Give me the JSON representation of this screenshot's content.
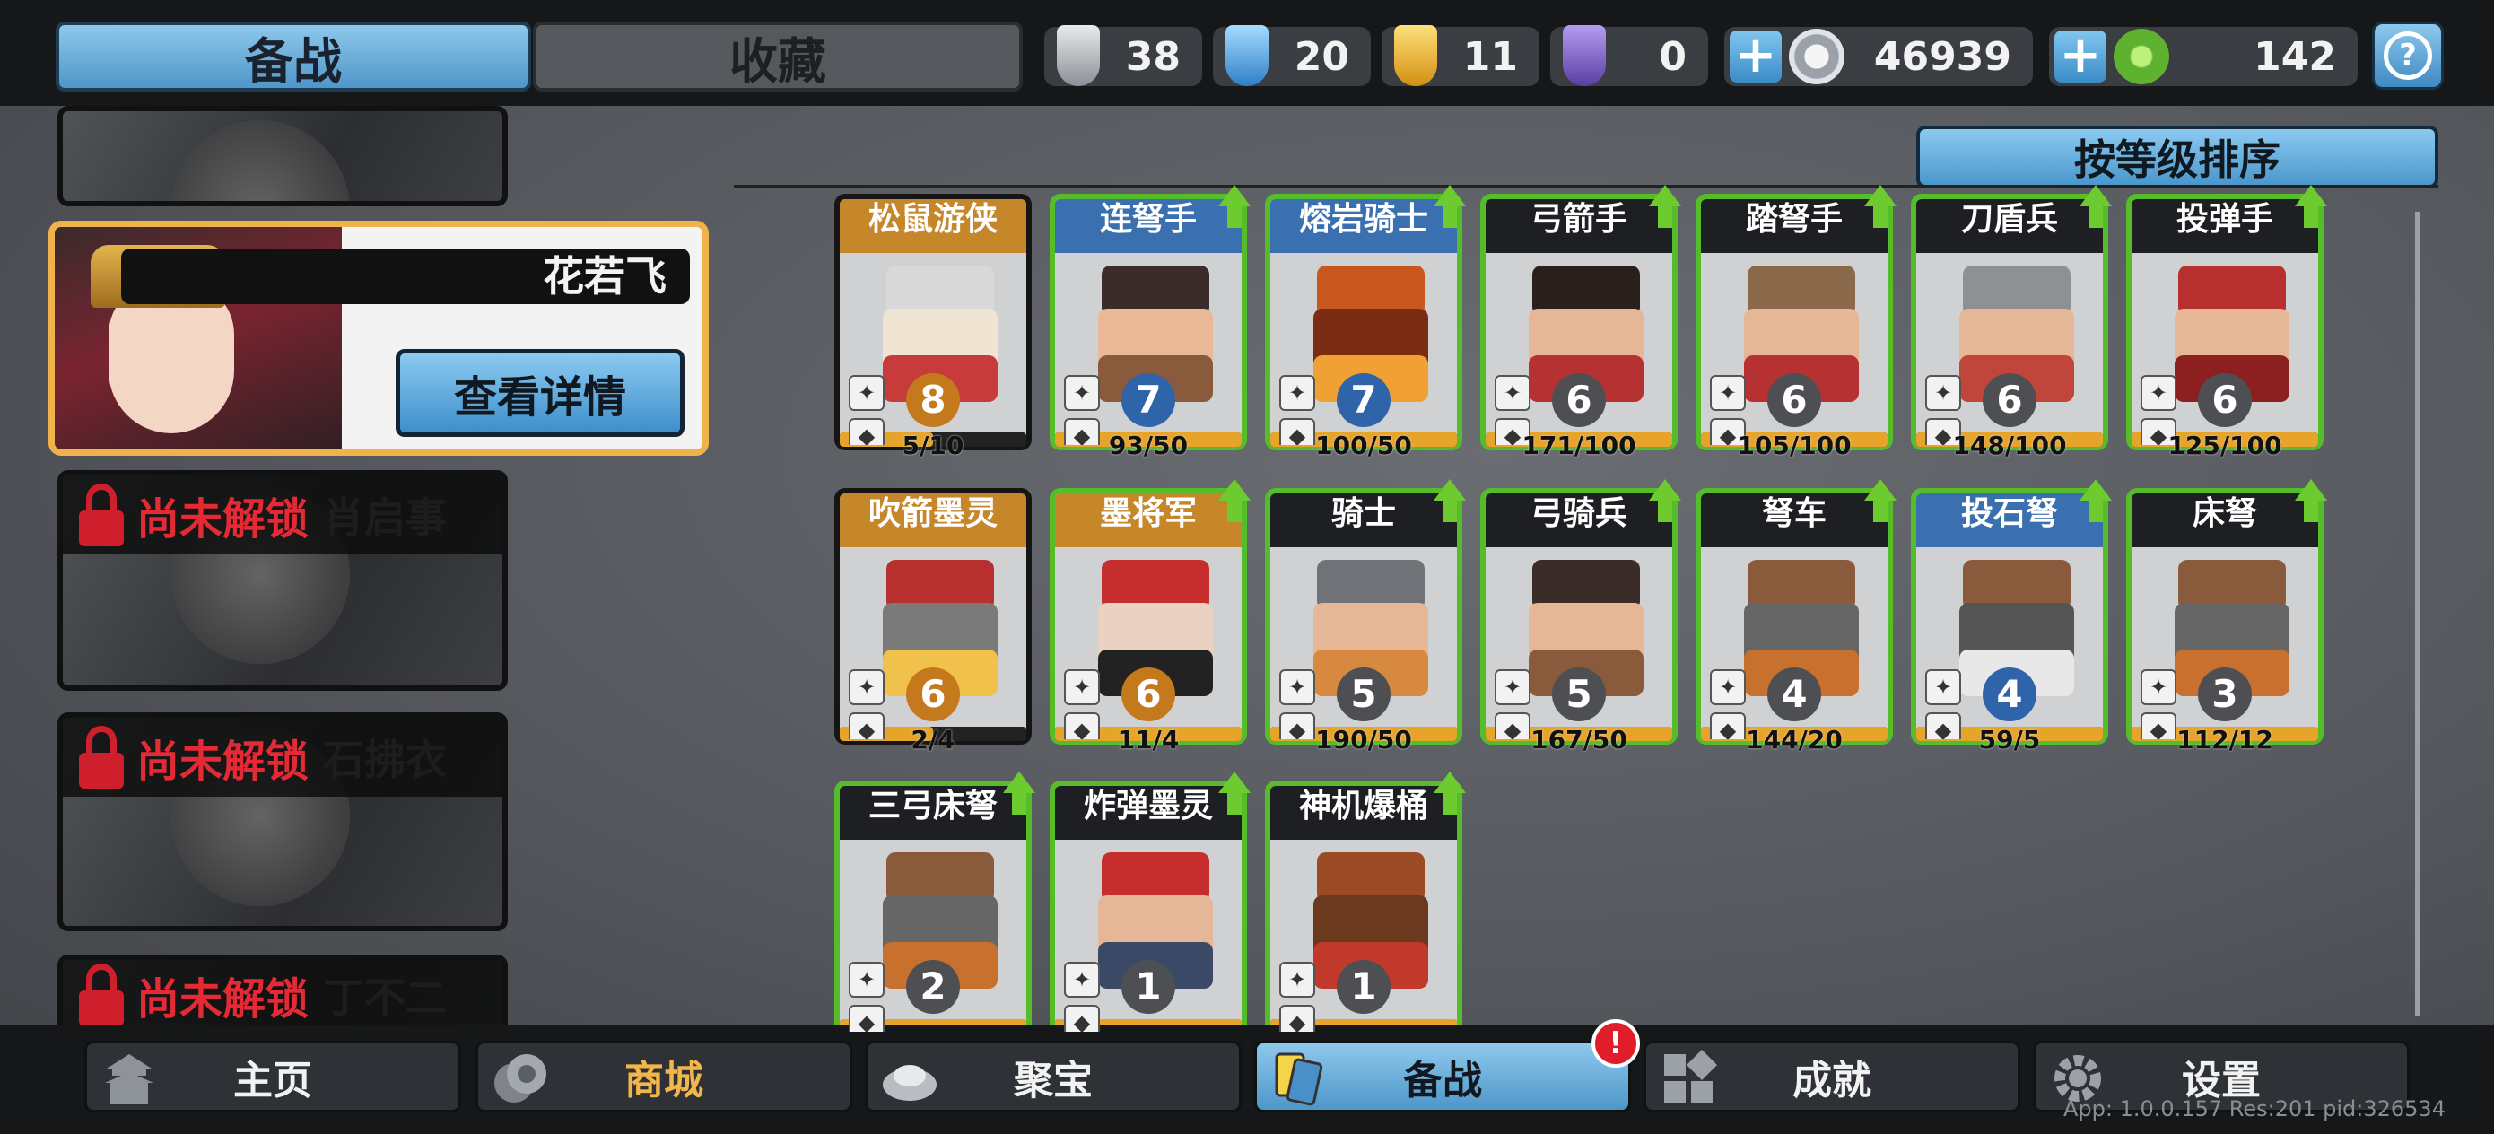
{
  "header": {
    "tab_active": "备战",
    "tab_inactive": "收藏",
    "resources": [
      {
        "icon": "silver-shield-icon",
        "value": "38",
        "color": "#bfc3c8"
      },
      {
        "icon": "blue-crystal-icon",
        "value": "20",
        "color": "#4fa8e6"
      },
      {
        "icon": "gold-shield-icon",
        "value": "11",
        "color": "#e6b02a"
      },
      {
        "icon": "purple-shield-icon",
        "value": "0",
        "color": "#7e5cc2"
      }
    ],
    "silver_coins": "46939",
    "jade": "142",
    "help_icon": "?"
  },
  "heroes": [
    {
      "type": "partial-top"
    },
    {
      "name": "花若飞",
      "detail_button": "查看详情",
      "selected": true
    },
    {
      "lock_text": "尚未解锁",
      "name": "肖启事"
    },
    {
      "lock_text": "尚未解锁",
      "name": "石拂衣"
    },
    {
      "lock_text": "尚未解锁",
      "name": "丁不二"
    }
  ],
  "sort_button": "按等级排序",
  "units": [
    {
      "name": "松鼠游侠",
      "level": "8",
      "progress": "5/10",
      "fill": 0.5,
      "header": "gold",
      "upgrade": false,
      "lvl": "gold"
    },
    {
      "name": "连弩手",
      "level": "7",
      "progress": "93/50",
      "fill": 1.0,
      "header": "blue",
      "upgrade": true,
      "lvl": "blue"
    },
    {
      "name": "熔岩骑士",
      "level": "7",
      "progress": "100/50",
      "fill": 1.0,
      "header": "blue",
      "upgrade": true,
      "lvl": "blue"
    },
    {
      "name": "弓箭手",
      "level": "6",
      "progress": "171/100",
      "fill": 1.0,
      "header": "dark",
      "upgrade": true,
      "lvl": "gray"
    },
    {
      "name": "踏弩手",
      "level": "6",
      "progress": "105/100",
      "fill": 1.0,
      "header": "dark",
      "upgrade": true,
      "lvl": "gray"
    },
    {
      "name": "刀盾兵",
      "level": "6",
      "progress": "148/100",
      "fill": 1.0,
      "header": "dark",
      "upgrade": true,
      "lvl": "gray"
    },
    {
      "name": "投弹手",
      "level": "6",
      "progress": "125/100",
      "fill": 1.0,
      "header": "dark",
      "upgrade": true,
      "lvl": "gray"
    },
    {
      "name": "吹箭墨灵",
      "level": "6",
      "progress": "2/4",
      "fill": 0.5,
      "header": "gold",
      "upgrade": false,
      "lvl": "gold"
    },
    {
      "name": "墨将军",
      "level": "6",
      "progress": "11/4",
      "fill": 1.0,
      "header": "gold",
      "upgrade": true,
      "lvl": "gold"
    },
    {
      "name": "骑士",
      "level": "5",
      "progress": "190/50",
      "fill": 1.0,
      "header": "dark",
      "upgrade": true,
      "lvl": "gray"
    },
    {
      "name": "弓骑兵",
      "level": "5",
      "progress": "167/50",
      "fill": 1.0,
      "header": "dark",
      "upgrade": true,
      "lvl": "gray"
    },
    {
      "name": "弩车",
      "level": "4",
      "progress": "144/20",
      "fill": 1.0,
      "header": "dark",
      "upgrade": true,
      "lvl": "gray"
    },
    {
      "name": "投石弩",
      "level": "4",
      "progress": "59/5",
      "fill": 1.0,
      "header": "blue",
      "upgrade": true,
      "lvl": "blue"
    },
    {
      "name": "床弩",
      "level": "3",
      "progress": "112/12",
      "fill": 1.0,
      "header": "dark",
      "upgrade": true,
      "lvl": "gray"
    },
    {
      "name": "三弓床弩",
      "level": "2",
      "progress": "",
      "fill": 1.0,
      "header": "dark",
      "upgrade": true,
      "lvl": "gray"
    },
    {
      "name": "炸弹墨灵",
      "level": "1",
      "progress": "",
      "fill": 1.0,
      "header": "dark",
      "upgrade": true,
      "lvl": "gray"
    },
    {
      "name": "神机爆桶",
      "level": "1",
      "progress": "",
      "fill": 1.0,
      "header": "dark",
      "upgrade": true,
      "lvl": "gray"
    }
  ],
  "nav": [
    {
      "label": "主页",
      "icon": "pagoda-icon"
    },
    {
      "label": "商城",
      "icon": "coins-icon"
    },
    {
      "label": "聚宝",
      "icon": "treasure-bowl-icon"
    },
    {
      "label": "备战",
      "icon": "cards-icon",
      "active": true
    },
    {
      "label": "成就",
      "icon": "grid-icon"
    },
    {
      "label": "设置",
      "icon": "gear-icon"
    }
  ],
  "nav_alert": "!",
  "version_text": "App: 1.0.0.157 Res:201 pid:326534"
}
